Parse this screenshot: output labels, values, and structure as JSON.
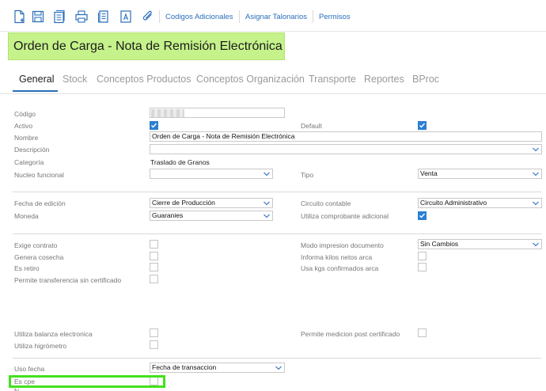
{
  "toolbar": {
    "icons": [
      "new-document-icon",
      "save-icon",
      "documents-icon",
      "print-icon",
      "list-icon",
      "text-document-icon",
      "attach-icon"
    ],
    "links": [
      "Codigos Adicionales",
      "Asignar Talonarios",
      "Permisos"
    ]
  },
  "page_title": "Orden de Carga - Nota de Remisión Electrónica",
  "tabs": [
    "General",
    "Stock",
    "Conceptos Productos",
    "Conceptos Organización",
    "Transporte",
    "Reportes",
    "BProc"
  ],
  "active_tab": "General",
  "form": {
    "codigo_label": "Código",
    "activo_label": "Activo",
    "activo_checked": true,
    "default_label": "Default",
    "default_checked": true,
    "nombre_label": "Nombre",
    "nombre_value": "Orden de Carga - Nota de Remisión Electrónica",
    "descripcion_label": "Descripción",
    "descripcion_value": "",
    "categoria_label": "Categoría",
    "categoria_value": "Traslado de Granos",
    "nucleo_label": "Nucleo funcional",
    "nucleo_value": "",
    "tipo_label": "Tipo",
    "tipo_value": "Venta",
    "fecha_edicion_label": "Fecha de edición",
    "fecha_edicion_value": "Cierre de Producción",
    "circuito_label": "Circuito contable",
    "circuito_value": "Circuito Administrativo",
    "moneda_label": "Moneda",
    "moneda_value": "Guaranies",
    "comprobante_adicional_label": "Utiliza comprobante adicional",
    "comprobante_adicional_checked": true,
    "exige_contrato_label": "Exige contrato",
    "genera_cosecha_label": "Genera cosecha",
    "es_retiro_label": "Es retiro",
    "permite_transferencia_label": "Permite transferencia sin certificado",
    "modo_impresion_label": "Modo impresion documento",
    "modo_impresion_value": "Sin Cambios",
    "informa_kilos_label": "Informa kilos netos arca",
    "usa_kgs_label": "Usa kgs confirmados arca",
    "balanza_label": "Utiliza balanza electronica",
    "higrometro_label": "Utiliza higrómetro",
    "medicion_label": "Permite medicion post certificado",
    "uso_fecha_label": "Uso fecha",
    "uso_fecha_value": "Fecha de transaccion",
    "es_cpe_label": "Es cpe",
    "cut_label": "N"
  },
  "colors": {
    "accent": "#2a6ebb",
    "title_bg": "#c5f28a",
    "highlight": "#45e01e",
    "checkbox_checked": "#2a7fd4"
  }
}
